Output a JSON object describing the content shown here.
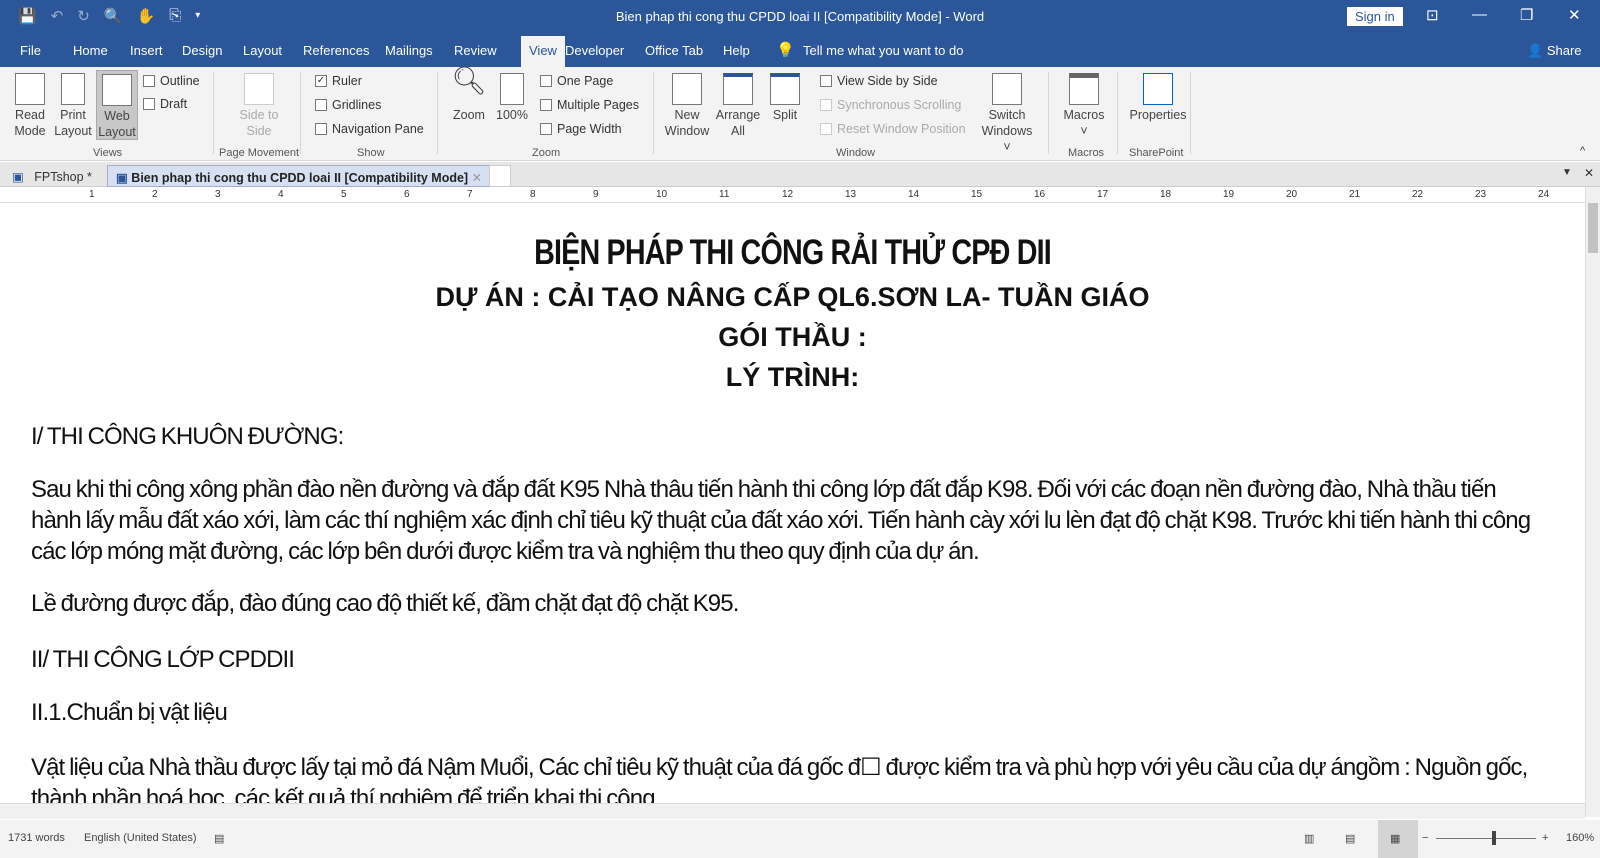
{
  "titlebar": {
    "title": "Bien phap thi cong thu CPDD loai II [Compatibility Mode]  -  Word",
    "sign_in": "Sign in"
  },
  "ribbon_tabs": [
    "File",
    "Home",
    "Insert",
    "Design",
    "Layout",
    "References",
    "Mailings",
    "Review",
    "View",
    "Developer",
    "Office Tab",
    "Help"
  ],
  "active_tab": "View",
  "tell_me": "Tell me what you want to do",
  "share": "Share",
  "ribbon": {
    "views": {
      "label": "Views",
      "read_mode": "Read Mode",
      "print_layout": "Print Layout",
      "web_layout": "Web Layout",
      "outline": "Outline",
      "draft": "Draft"
    },
    "page_movement": {
      "label": "Page Movement",
      "side_to_side": "Side to Side"
    },
    "show": {
      "label": "Show",
      "ruler": "Ruler",
      "ruler_checked": true,
      "gridlines": "Gridlines",
      "gridlines_checked": false,
      "navigation_pane": "Navigation Pane",
      "navigation_pane_checked": false
    },
    "zoom": {
      "label": "Zoom",
      "zoom": "Zoom",
      "hundred": "100%",
      "one_page": "One Page",
      "multiple_pages": "Multiple Pages",
      "page_width": "Page Width"
    },
    "window": {
      "label": "Window",
      "new_window": "New Window",
      "arrange_all": "Arrange All",
      "split": "Split",
      "view_side_by_side": "View Side by Side",
      "synchronous_scrolling": "Synchronous Scrolling",
      "reset_window_position": "Reset Window Position",
      "switch_windows": "Switch Windows"
    },
    "macros": {
      "label": "Macros",
      "macros": "Macros"
    },
    "sharepoint": {
      "label": "SharePoint",
      "properties": "Properties"
    }
  },
  "doc_tabs": [
    "FPTshop *",
    "Bien phap thi cong thu CPDD loai II [Compatibility Mode]"
  ],
  "ruler_numbers": [
    "1",
    "2",
    "3",
    "4",
    "5",
    "6",
    "7",
    "8",
    "9",
    "10",
    "11",
    "12",
    "13",
    "14",
    "15",
    "16",
    "17",
    "18",
    "19",
    "20",
    "21",
    "22",
    "23",
    "24"
  ],
  "document": {
    "title": "BIỆN PHÁP THI CÔNG RẢI THỬ CPĐ DII",
    "project": "DỰ ÁN : CẢI TẠO NÂNG CẤP QL6.SƠN LA- TUẦN GIÁO",
    "package": "GÓI THẦU :",
    "route": "LÝ TRÌNH:",
    "paragraphs": [
      "I/ THI CÔNG KHUÔN ĐƯỜNG:",
      "Sau khi thi công xông phần đào nền đường và đắp đất K95 Nhà thâu tiến hành thi công lớp đất đắp K98. Đối với các đoạn nền đường đào, Nhà thầu tiến hành lấy mẫu đất xáo xới, làm các thí nghiệm xác định chỉ tiêu kỹ thuật của đất xáo xới. Tiến hành cày xới lu lèn đạt độ chặt K98. Trước khi tiến hành thi công các lớp móng mặt đường, các lớp bên dưới được kiểm tra và nghiệm thu theo quy định của dự án.",
      "Lề đường được đắp, đào đúng cao độ thiết kế, đầm chặt đạt độ chặt K95.",
      "II/ THI CÔNG LỚP CPDDII",
      "II.1.Chuẩn bị vật liệu",
      "Vật liệu của Nhà thầu được lấy tại mỏ đá Nậm Muổi, Các chỉ tiêu kỹ thuật của đá gốc đ☐ được kiểm tra và phù hợp với yêu cầu của dự ángồm : Nguồn gốc, thành phần hoá học, các kết quả thí nghiệm để triển khai thi công."
    ]
  },
  "status": {
    "words": "1731 words",
    "language": "English (United States)",
    "zoom": "160%"
  }
}
